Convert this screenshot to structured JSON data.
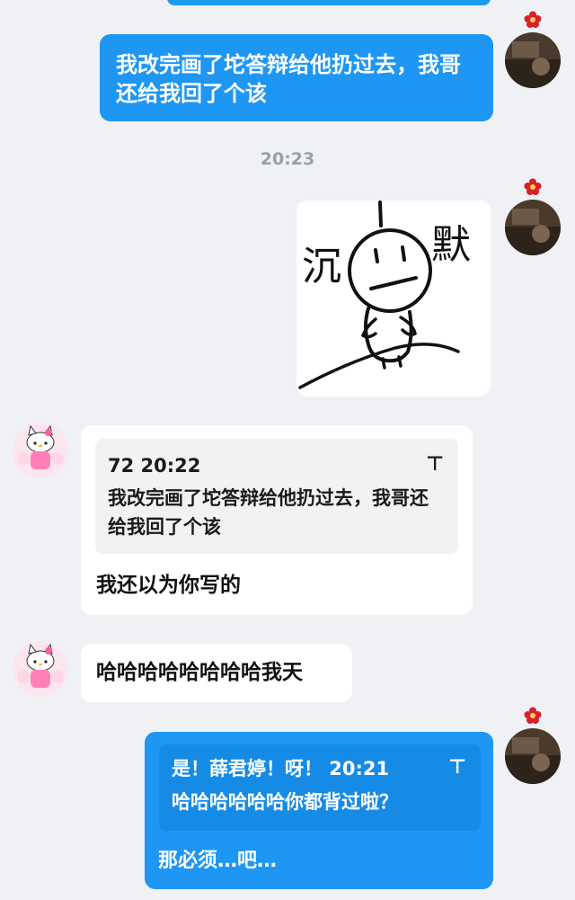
{
  "messages": {
    "m1_text": "我改完画了坨答辩给他扔过去，我哥还给我回了个该",
    "time_divider": "20:23",
    "sticker_chars": {
      "left": "沉",
      "right": "默"
    },
    "m3_quote_meta": "72 20:22",
    "m3_quote_text": "我改完画了坨答辩给他扔过去，我哥还给我回了个该",
    "m3_text": "我还以为你写的",
    "m4_text": "哈哈哈哈哈哈哈哈我天",
    "m5_quote_meta": "是！薛君婷！呀！ 20:21",
    "m5_quote_text": "哈哈哈哈哈哈你都背过啦？",
    "m5_text": "那必须…吧…"
  },
  "icons": {
    "quote_pin": "pin-top-icon",
    "avatar_me": "dark-photo-avatar",
    "avatar_them": "hello-kitty-avatar",
    "avatar_badge": "red-flower-icon"
  },
  "colors": {
    "background": "#f0f1f5",
    "bubble_out": "#1e96f4",
    "bubble_in": "#ffffff",
    "badge": "#d8202a"
  }
}
